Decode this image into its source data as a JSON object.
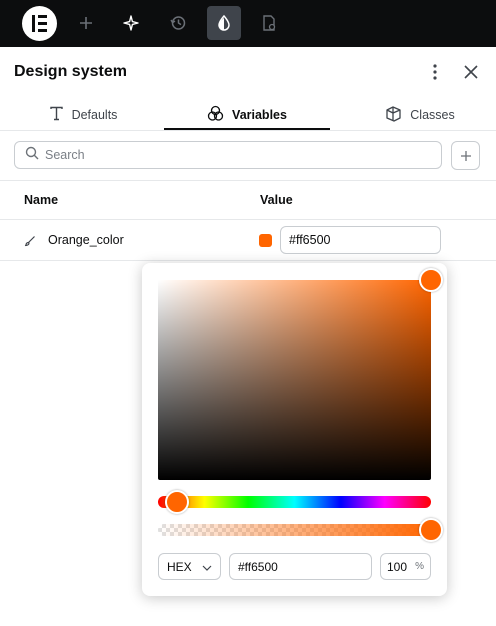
{
  "topbar": {
    "icons": [
      "elementor-logo-icon",
      "plus-icon",
      "sparkle-icon",
      "history-icon",
      "droplet-icon",
      "page-settings-icon"
    ]
  },
  "header": {
    "title": "Design system"
  },
  "tabs": [
    {
      "label": "Defaults",
      "icon": "text-icon"
    },
    {
      "label": "Variables",
      "icon": "circles-icon",
      "active": true
    },
    {
      "label": "Classes",
      "icon": "cube-icon"
    }
  ],
  "search": {
    "placeholder": "Search"
  },
  "table": {
    "headers": {
      "name": "Name",
      "value": "Value"
    },
    "rows": [
      {
        "name": "Orange_color",
        "value": "#ff6500",
        "swatch": "#ff6500",
        "icon": "brush-icon"
      }
    ]
  },
  "picker": {
    "format": "HEX",
    "hex": "#ff6500",
    "opacity": "100",
    "opacity_unit": "%",
    "color": "#ff6500",
    "hue_fraction": 0.07,
    "alpha_fraction": 1.0
  },
  "colors": {
    "topbar": "#0c0d0e",
    "accent": "#ff6500"
  }
}
